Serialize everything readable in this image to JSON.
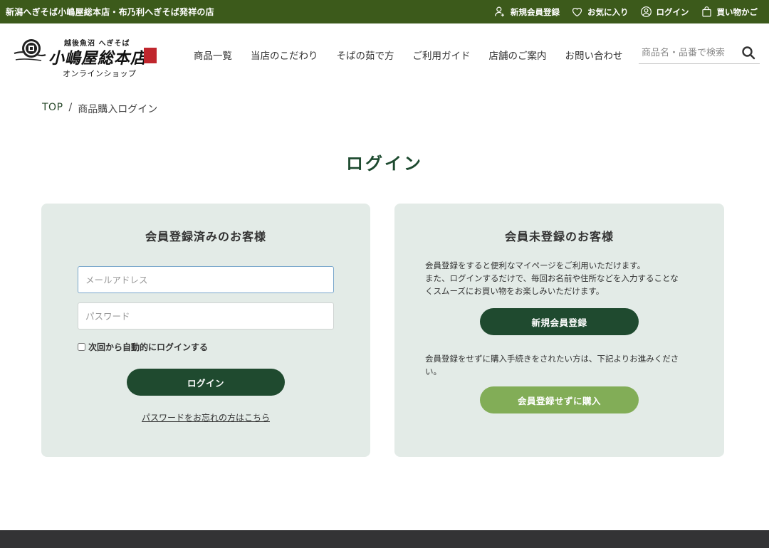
{
  "topbar": {
    "tagline": "新潟へぎそば小嶋屋総本店・布乃利へぎそば発祥の店",
    "links": [
      {
        "label": "新規会員登録",
        "icon": "user-plus-icon"
      },
      {
        "label": "お気に入り",
        "icon": "heart-icon"
      },
      {
        "label": "ログイン",
        "icon": "user-circle-icon"
      },
      {
        "label": "買い物かご",
        "icon": "shopping-bag-icon"
      }
    ]
  },
  "logo": {
    "subtitle": "越後魚沼 へぎそば",
    "brand": "小嶋屋総本店",
    "shop": "オンラインショップ"
  },
  "nav": {
    "items": [
      "商品一覧",
      "当店のこだわり",
      "そばの茹で方",
      "ご利用ガイド",
      "店舗のご案内",
      "お問い合わせ"
    ]
  },
  "search": {
    "placeholder": "商品名・品番で検索"
  },
  "breadcrumb": {
    "top": "TOP",
    "separator": "/",
    "current": "商品購入ログイン"
  },
  "page": {
    "title": "ログイン"
  },
  "member": {
    "heading": "会員登録済みのお客様",
    "email_placeholder": "メールアドレス",
    "password_placeholder": "パスワード",
    "remember_label": "次回から自動的にログインする",
    "login_button": "ログイン",
    "forgot_link": "パスワードをお忘れの方はこちら"
  },
  "guest": {
    "heading": "会員未登録のお客様",
    "description1_line1": "会員登録をすると便利なマイページをご利用いただけます。",
    "description1_line2": "また、ログインするだけで、毎回お名前や住所などを入力することな",
    "description1_line3": "くスムーズにお買い物をお楽しみいただけます。",
    "register_button": "新規会員登録",
    "description2_line1": "会員登録をせずに購入手続きをされたい方は、下記よりお進みくださ",
    "description2_line2": "い。",
    "guest_button": "会員登録せずに購入"
  },
  "colors": {
    "topbar": "#3c5a1b",
    "primary_button": "#1f4a2f",
    "secondary_button": "#82ad57",
    "card_background": "#e3ebe7",
    "title": "#1d4a2f"
  }
}
